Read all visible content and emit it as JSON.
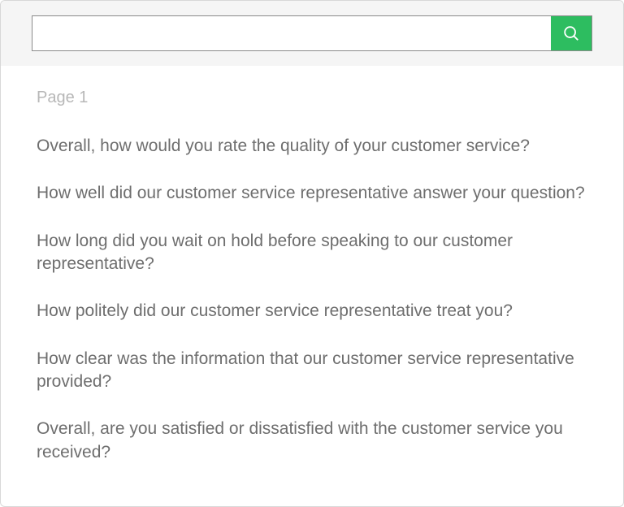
{
  "search": {
    "value": "",
    "placeholder": ""
  },
  "pageLabel": "Page 1",
  "questions": [
    "Overall, how would you rate the quality of your customer service?",
    "How well did our customer service representative answer your question?",
    "How long did you wait on hold before speaking to our customer representative?",
    "How politely did our customer service representative treat you?",
    "How clear was the information that our customer service representative provided?",
    "Overall, are you satisfied or dissatisfied with the customer service you received?"
  ]
}
